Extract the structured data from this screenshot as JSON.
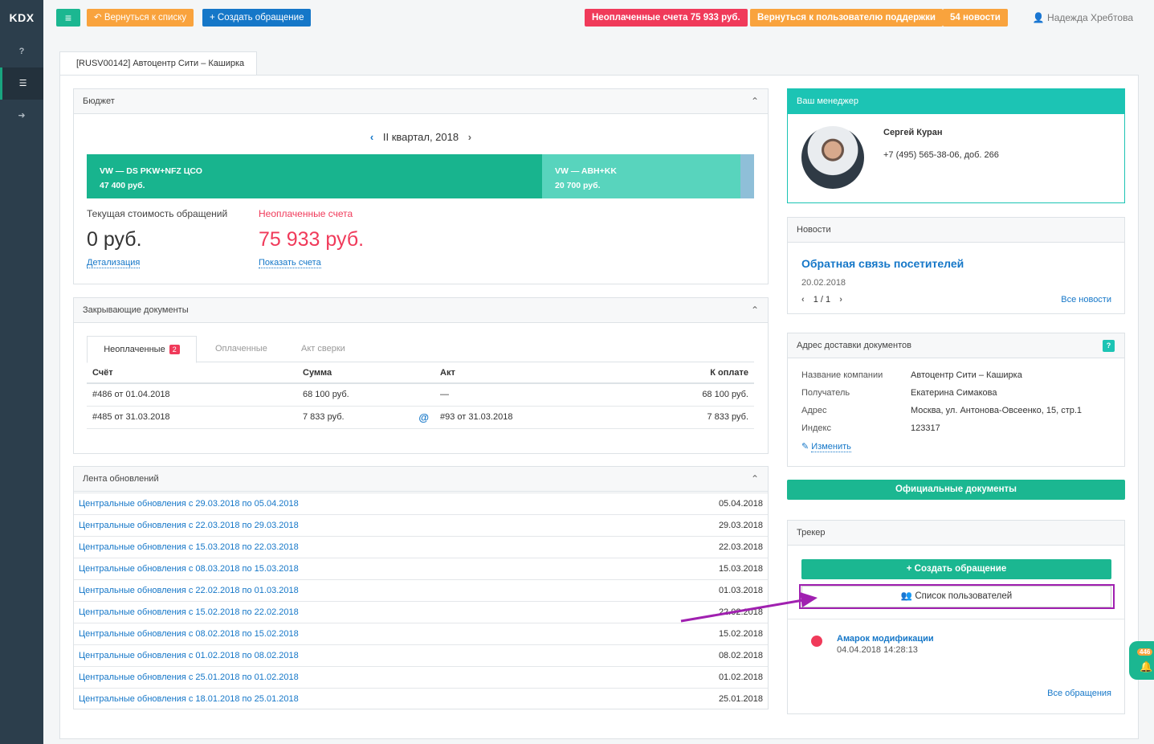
{
  "sidebar": {
    "logo": "KDX",
    "items": [
      {
        "label": "?",
        "icon": "question-icon"
      },
      {
        "label": "☰",
        "icon": "list-icon"
      },
      {
        "label": "➜",
        "icon": "signout-icon"
      }
    ]
  },
  "topbar": {
    "menu_icon": "≡",
    "back_label": "↶ Вернуться к списку",
    "create_label": "+ Создать обращение",
    "unpaid_label": "Неоплаченные счета 75 933 руб.",
    "support_label": "Вернуться к пользователю поддержки",
    "news_label": "54 новости",
    "user_name": "Надежда Хребтова"
  },
  "tab": {
    "label": "[RUSV00142] Автоцентр Сити – Каширка"
  },
  "budget": {
    "title": "Бюджет",
    "period": "II квартал, 2018",
    "segments": [
      {
        "name": "VW — DS PKW+NFZ ЦСО",
        "amount": "47 400 руб.",
        "color": "#18b48e"
      },
      {
        "name": "VW — ABH+KK",
        "amount": "20 700 руб.",
        "color": "#58d4bd"
      }
    ],
    "current_label": "Текущая стоимость обращений",
    "current_value": "0 руб.",
    "current_link": "Детализация",
    "unpaid_label": "Неоплаченные счета",
    "unpaid_value": "75 933 руб.",
    "unpaid_link": "Показать счета"
  },
  "closing_docs": {
    "title": "Закрывающие документы",
    "tabs": [
      {
        "label": "Неоплаченные",
        "badge": "2"
      },
      {
        "label": "Оплаченные"
      },
      {
        "label": "Акт сверки"
      }
    ],
    "headers": [
      "Счёт",
      "Сумма",
      "Акт",
      "К оплате"
    ],
    "rows": [
      {
        "invoice": "#486 от 01.04.2018",
        "sum": "68 100 руб.",
        "act_icon": "",
        "act": "—",
        "due": "68 100 руб."
      },
      {
        "invoice": "#485 от 31.03.2018",
        "sum": "7 833 руб.",
        "act_icon": "@",
        "act": "#93 от 31.03.2018",
        "due": "7 833 руб."
      }
    ]
  },
  "feed": {
    "title": "Лента обновлений",
    "rows": [
      {
        "label": "Центральные обновления с 29.03.2018 по 05.04.2018",
        "date": "05.04.2018"
      },
      {
        "label": "Центральные обновления с 22.03.2018 по 29.03.2018",
        "date": "29.03.2018"
      },
      {
        "label": "Центральные обновления с 15.03.2018 по 22.03.2018",
        "date": "22.03.2018"
      },
      {
        "label": "Центральные обновления с 08.03.2018 по 15.03.2018",
        "date": "15.03.2018"
      },
      {
        "label": "Центральные обновления с 22.02.2018 по 01.03.2018",
        "date": "01.03.2018"
      },
      {
        "label": "Центральные обновления с 15.02.2018 по 22.02.2018",
        "date": "22.02.2018"
      },
      {
        "label": "Центральные обновления с 08.02.2018 по 15.02.2018",
        "date": "15.02.2018"
      },
      {
        "label": "Центральные обновления с 01.02.2018 по 08.02.2018",
        "date": "08.02.2018"
      },
      {
        "label": "Центральные обновления с 25.01.2018 по 01.02.2018",
        "date": "01.02.2018"
      },
      {
        "label": "Центральные обновления с 18.01.2018 по 25.01.2018",
        "date": "25.01.2018"
      }
    ]
  },
  "manager": {
    "title": "Ваш менеджер",
    "name": "Сергей Куран",
    "phone": "+7 (495) 565-38-06, доб. 266"
  },
  "news": {
    "title": "Новости",
    "headline": "Обратная связь посетителей",
    "date": "20.02.2018",
    "pager": "1 / 1",
    "all_link": "Все новости"
  },
  "address": {
    "title": "Адрес доставки документов",
    "help": "?",
    "fields": [
      {
        "key": "Название компании",
        "value": "Автоцентр Сити – Каширка"
      },
      {
        "key": "Получатель",
        "value": "Екатерина Симакова"
      },
      {
        "key": "Адрес",
        "value": "Москва, ул. Антонова-Овсеенко, 15, стр.1"
      },
      {
        "key": "Индекс",
        "value": "123317"
      }
    ],
    "edit_link": "Изменить"
  },
  "official_docs_label": "Официальные документы",
  "tracker": {
    "title": "Трекер",
    "create_label": "+  Создать обращение",
    "users_label": "Список пользователей",
    "item_title": "Амарок модификации",
    "item_date": "04.04.2018 14:28:13",
    "all_link": "Все обращения"
  },
  "notif": {
    "count": "446"
  },
  "colors": {
    "accent": "#1bb791",
    "danger": "#f03a5a",
    "link": "#1577c8",
    "annotation": "#a020b0"
  }
}
